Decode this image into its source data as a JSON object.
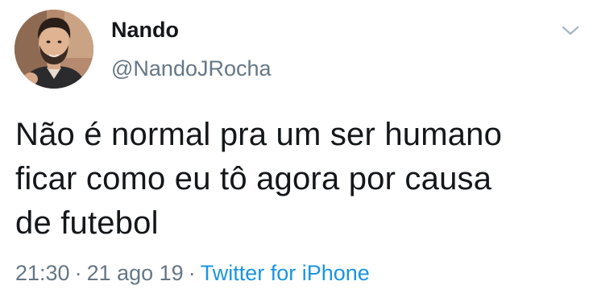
{
  "author": {
    "display_name": "Nando",
    "handle": "@NandoJRocha",
    "avatar_icon": "profile-photo"
  },
  "menu": {
    "icon": "chevron-down-icon",
    "color": "#aab8c2"
  },
  "tweet": {
    "text_lines": [
      "Não é normal pra um ser humano",
      "ficar como eu tô agora por causa",
      "de futebol"
    ]
  },
  "meta": {
    "time": "21:30",
    "date": "21 ago 19",
    "separator": "·",
    "source": "Twitter for iPhone"
  },
  "colors": {
    "text_primary": "#14171a",
    "text_secondary": "#657786",
    "link": "#1b95e0"
  }
}
